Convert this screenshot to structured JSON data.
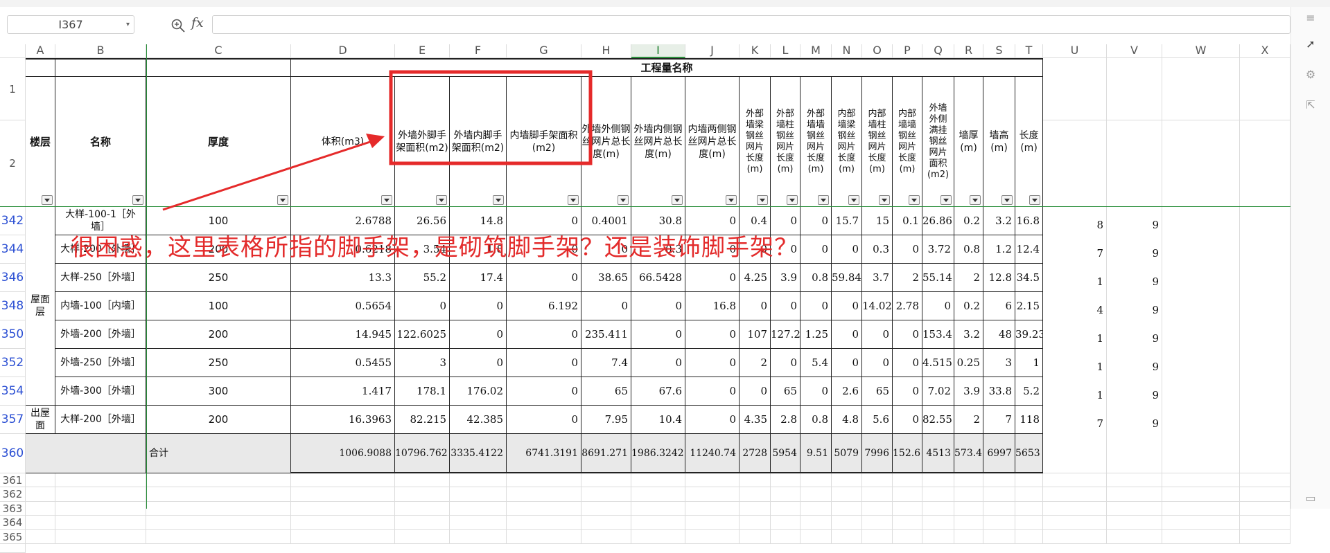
{
  "formula_bar": {
    "cell_ref": "I367",
    "fx_label": "fx",
    "formula": ""
  },
  "columns": [
    "A",
    "B",
    "C",
    "D",
    "E",
    "F",
    "G",
    "H",
    "I",
    "J",
    "K",
    "L",
    "M",
    "N",
    "O",
    "P",
    "Q",
    "R",
    "S",
    "T",
    "U",
    "V",
    "W",
    "X"
  ],
  "row_labels": {
    "r1": "1",
    "r2": "2"
  },
  "header": {
    "group_title": "工程量名称",
    "floor": "楼层",
    "name": "名称",
    "thickness": "厚度",
    "volume": "体积(m3)",
    "e": "外墙外脚手架面积(m2)",
    "f": "外墙内脚手架面积(m2)",
    "g": "内墙脚手架面积(m2)",
    "h": "外墙外侧钢丝网片总长度(m)",
    "i": "外墙内侧钢丝网片总长度(m)",
    "j": "内墙两侧钢丝网片总长度(m)",
    "k": "外部墙梁钢丝网片长度(m)",
    "l": "外部墙柱钢丝网片长度(m)",
    "m": "外部墙墙钢丝网片长度(m)",
    "n": "内部墙梁钢丝网片长度(m)",
    "o": "内部墙柱钢丝网片长度(m)",
    "p": "内部墙墙钢丝网片长度(m)",
    "q": "外墙外侧满挂钢丝网片面积(m2)",
    "r": "墙厚(m)",
    "s": "墙高(m)",
    "t": "长度(m)"
  },
  "floor_groups": [
    {
      "label": "屋面层"
    },
    {
      "label": "出屋面"
    }
  ],
  "rows": [
    {
      "row": "342",
      "name": "大样-100-1［外墙］",
      "c": "100",
      "d": "2.6788",
      "e": "26.56",
      "f": "14.8",
      "g": "0",
      "h": "0.4001",
      "i": "30.8",
      "j": "0",
      "k": "0.4",
      "l": "0",
      "m": "0",
      "n": "15.7",
      "o": "15",
      "p": "0.1",
      "q": "26.86",
      "r": "0.2",
      "s": "3.2",
      "t": "16.8",
      "u": "8",
      "v": "9"
    },
    {
      "row": "344",
      "name": "大样-200［外墙］",
      "c": "200",
      "d": "0.6218",
      "e": "3.54",
      "f": "1.8",
      "g": "0",
      "h": "0",
      "i": "0.3",
      "j": "0",
      "k": "0",
      "l": "0",
      "m": "0",
      "n": "0",
      "o": "0.3",
      "p": "0",
      "q": "3.72",
      "r": "0.8",
      "s": "1.2",
      "t": "12.4",
      "u": "7",
      "v": "9"
    },
    {
      "row": "346",
      "name": "大样-250［外墙］",
      "c": "250",
      "d": "13.3",
      "e": "55.2",
      "f": "17.4",
      "g": "0",
      "h": "38.65",
      "i": "66.5428",
      "j": "0",
      "k": "4.25",
      "l": "3.9",
      "m": "0.8",
      "n": "59.84",
      "o": "3.7",
      "p": "2",
      "q": "55.14",
      "r": "2",
      "s": "12.8",
      "t": "34.5",
      "u": "1",
      "v": "9"
    },
    {
      "row": "348",
      "name": "内墙-100［内墙］",
      "c": "100",
      "d": "0.5654",
      "e": "0",
      "f": "0",
      "g": "6.192",
      "h": "0",
      "i": "0",
      "j": "16.8",
      "k": "0",
      "l": "0",
      "m": "0",
      "n": "0",
      "o": "14.02",
      "p": "2.78",
      "q": "0",
      "r": "0.2",
      "s": "6",
      "t": "2.15",
      "u": "4",
      "v": "9"
    },
    {
      "row": "350",
      "name": "外墙-200［外墙］",
      "c": "200",
      "d": "14.945",
      "e": "122.6025",
      "f": "0",
      "g": "0",
      "h": "235.411",
      "i": "0",
      "j": "0",
      "k": "107",
      "l": "127.2",
      "m": "1.25",
      "n": "0",
      "o": "0",
      "p": "0",
      "q": "153.4",
      "r": "3.2",
      "s": "48",
      "t": "39.23",
      "u": "1",
      "v": "9"
    },
    {
      "row": "352",
      "name": "外墙-250［外墙］",
      "c": "250",
      "d": "0.5455",
      "e": "3",
      "f": "0",
      "g": "0",
      "h": "7.4",
      "i": "0",
      "j": "0",
      "k": "2",
      "l": "0",
      "m": "5.4",
      "n": "0",
      "o": "0",
      "p": "0",
      "q": "4.515",
      "r": "0.25",
      "s": "3",
      "t": "1",
      "u": "1",
      "v": "9"
    },
    {
      "row": "354",
      "name": "外墙-300［外墙］",
      "c": "300",
      "d": "1.417",
      "e": "178.1",
      "f": "176.02",
      "g": "0",
      "h": "65",
      "i": "67.6",
      "j": "0",
      "k": "0",
      "l": "65",
      "m": "0",
      "n": "2.6",
      "o": "65",
      "p": "0",
      "q": "7.02",
      "r": "3.9",
      "s": "33.8",
      "t": "5.2",
      "u": "1",
      "v": "9"
    },
    {
      "row": "357",
      "name": "大样-200［外墙］",
      "c": "200",
      "d": "16.3963",
      "e": "82.215",
      "f": "42.385",
      "g": "0",
      "h": "7.95",
      "i": "10.4",
      "j": "0",
      "k": "4.35",
      "l": "2.8",
      "m": "0.8",
      "n": "4.8",
      "o": "5.6",
      "p": "0",
      "q": "82.55",
      "r": "2",
      "s": "7",
      "t": "118",
      "u": "7",
      "v": "9"
    }
  ],
  "total": {
    "row": "360",
    "label": "合计",
    "d": "1006.9088",
    "e": "10796.762",
    "f": "3335.4122",
    "g": "6741.3191",
    "h": "8691.271",
    "i": "1986.3242",
    "j": "11240.74",
    "k": "2728",
    "l": "5954",
    "m": "9.51",
    "n": "5079",
    "o": "7996",
    "p": "152.6",
    "q": "4513",
    "r": "573.4",
    "s": "6997",
    "t": "5653"
  },
  "empty_rows": [
    "361",
    "362",
    "363",
    "364",
    "365"
  ],
  "annotation": "很困惑，这里表格所指的脚手架，是砌筑脚手架？还是装饰脚手架？",
  "colors": {
    "annotation_red": "#e32b2b",
    "row_number_blue": "#2b4fd3",
    "selected_col_green": "#2b8f3c",
    "total_row_bg": "#e9e9e9"
  }
}
